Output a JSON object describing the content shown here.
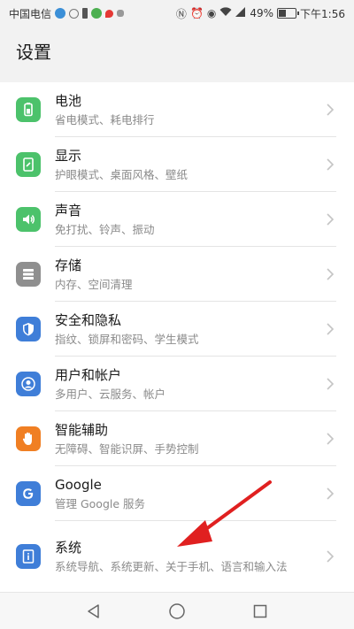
{
  "status_bar": {
    "carrier": "中国电信",
    "battery": "49%",
    "time": "下午1:56"
  },
  "header": {
    "title": "设置"
  },
  "items": [
    {
      "title": "电池",
      "subtitle": "省电模式、耗电排行",
      "icon": "battery-icon",
      "color": "#4cc26b"
    },
    {
      "title": "显示",
      "subtitle": "护眼模式、桌面风格、壁纸",
      "icon": "display-icon",
      "color": "#4cc26b"
    },
    {
      "title": "声音",
      "subtitle": "免打扰、铃声、振动",
      "icon": "sound-icon",
      "color": "#4cc26b"
    },
    {
      "title": "存储",
      "subtitle": "内存、空间清理",
      "icon": "storage-icon",
      "color": "#8f8f8f"
    },
    {
      "title": "安全和隐私",
      "subtitle": "指纹、锁屏和密码、学生模式",
      "icon": "shield-icon",
      "color": "#3f7ed8"
    },
    {
      "title": "用户和帐户",
      "subtitle": "多用户、云服务、帐户",
      "icon": "user-icon",
      "color": "#3f7ed8"
    },
    {
      "title": "智能辅助",
      "subtitle": "无障碍、智能识屏、手势控制",
      "icon": "hand-icon",
      "color": "#f07f23"
    },
    {
      "title": "Google",
      "subtitle": "管理 Google 服务",
      "icon": "google-icon",
      "color": "#3f7ed8"
    },
    {
      "title": "系统",
      "subtitle": "系统导航、系统更新、关于手机、语言和输入法",
      "icon": "info-icon",
      "color": "#3f7ed8"
    }
  ],
  "colors": {
    "annotation_arrow": "#e02020"
  }
}
